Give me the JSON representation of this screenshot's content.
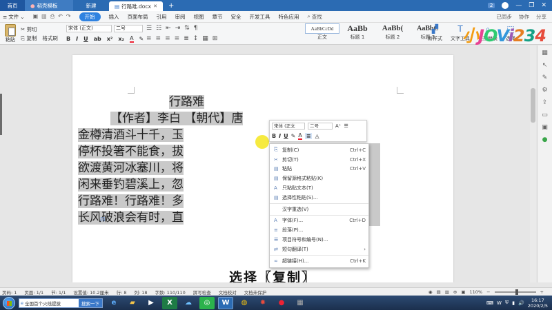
{
  "tabs": {
    "home": "首页",
    "templates": "稻壳模板",
    "new": "新建",
    "document": "行路难.docx",
    "badge": "2"
  },
  "menu": {
    "file": "文件",
    "items": [
      "开始",
      "插入",
      "页面布局",
      "引用",
      "审阅",
      "视图",
      "章节",
      "安全",
      "开发工具",
      "特色应用"
    ],
    "find": "查找",
    "sync": "已同步",
    "collab": "协作",
    "share": "分享"
  },
  "ribbon": {
    "paste": "粘贴",
    "cut": "剪切",
    "copy": "复制",
    "format_painter": "格式刷",
    "font_name": "宋体 (正文)",
    "font_size": "二号",
    "bold": "B",
    "italic": "I",
    "underline": "U",
    "styles": [
      {
        "preview": "AaBbCcDd",
        "name": "正文"
      },
      {
        "preview": "AaBb",
        "name": "标题 1"
      },
      {
        "preview": "AaBb(",
        "name": "标题 2"
      },
      {
        "preview": "AaBbC",
        "name": "标题 3"
      }
    ],
    "new_style": "新样式",
    "text_tools": "文字工具",
    "find_replace": "查找替换",
    "select": "选择"
  },
  "document": {
    "title": "行路难",
    "author_line": "【作者】李白 【朝代】唐",
    "body_lines": [
      "金樽清酒斗十千，玉",
      "停杯投箸不能食，拔",
      "欲渡黄河冰塞川，将",
      "闲来垂钓碧溪上，忽",
      "行路难！行路难！多",
      "长风破浪会有时，直"
    ]
  },
  "mini_toolbar": {
    "font_name": "宋体 (正文",
    "font_size": "二号",
    "bold": "B",
    "italic": "I",
    "underline": "U",
    "font_color": "A"
  },
  "context_menu": [
    {
      "label": "复制(C)",
      "shortcut": "Ctrl+C",
      "icon": "copy-icon",
      "glyph": "⎘"
    },
    {
      "label": "剪切(T)",
      "shortcut": "Ctrl+X",
      "icon": "scissors-icon",
      "glyph": "✂"
    },
    {
      "label": "粘贴",
      "shortcut": "Ctrl+V",
      "icon": "paste-icon",
      "glyph": "▤"
    },
    {
      "label": "保留源格式粘贴(K)",
      "shortcut": "",
      "icon": "paste-keep-format-icon",
      "glyph": "▤"
    },
    {
      "label": "只粘贴文本(T)",
      "shortcut": "",
      "icon": "paste-text-icon",
      "glyph": "A"
    },
    {
      "label": "选择性粘贴(S)...",
      "shortcut": "",
      "icon": "paste-special-icon",
      "glyph": "▤"
    },
    {
      "sep": true
    },
    {
      "label": "汉字重选(V)",
      "shortcut": "",
      "icon": "",
      "glyph": ""
    },
    {
      "sep": true
    },
    {
      "label": "字体(F)...",
      "shortcut": "Ctrl+D",
      "icon": "font-icon",
      "glyph": "A"
    },
    {
      "label": "段落(P)...",
      "shortcut": "",
      "icon": "paragraph-icon",
      "glyph": "≡"
    },
    {
      "label": "项目符号和编号(N)...",
      "shortcut": "",
      "icon": "bullets-icon",
      "glyph": "☰"
    },
    {
      "label": "短句翻译(T)",
      "shortcut": "›",
      "icon": "translate-icon",
      "glyph": "⇄"
    },
    {
      "sep": true
    },
    {
      "label": "超链接(H)...",
      "shortcut": "Ctrl+K",
      "icon": "hyperlink-icon",
      "glyph": "∞"
    }
  ],
  "caption": "选择〖复制〗",
  "statusbar": {
    "page_no": "页码: 1",
    "page": "页面: 1/1",
    "section": "节: 1/1",
    "setting": "设置值: 10.2厘米",
    "row": "行: 8",
    "col": "列: 18",
    "words": "字数: 110/110",
    "spell": "拼写检查",
    "proof": "文档校对",
    "protect": "文档未保护",
    "zoom": "110%"
  },
  "taskbar": {
    "search_text": "全国首个火线提拔",
    "search_button": "搜索一下",
    "time": "16:17",
    "date": "2020/2/5"
  },
  "colors": {
    "accent": "#2b6bb3",
    "selection": "#c9c9c9",
    "start_button": "#2f82e0"
  }
}
